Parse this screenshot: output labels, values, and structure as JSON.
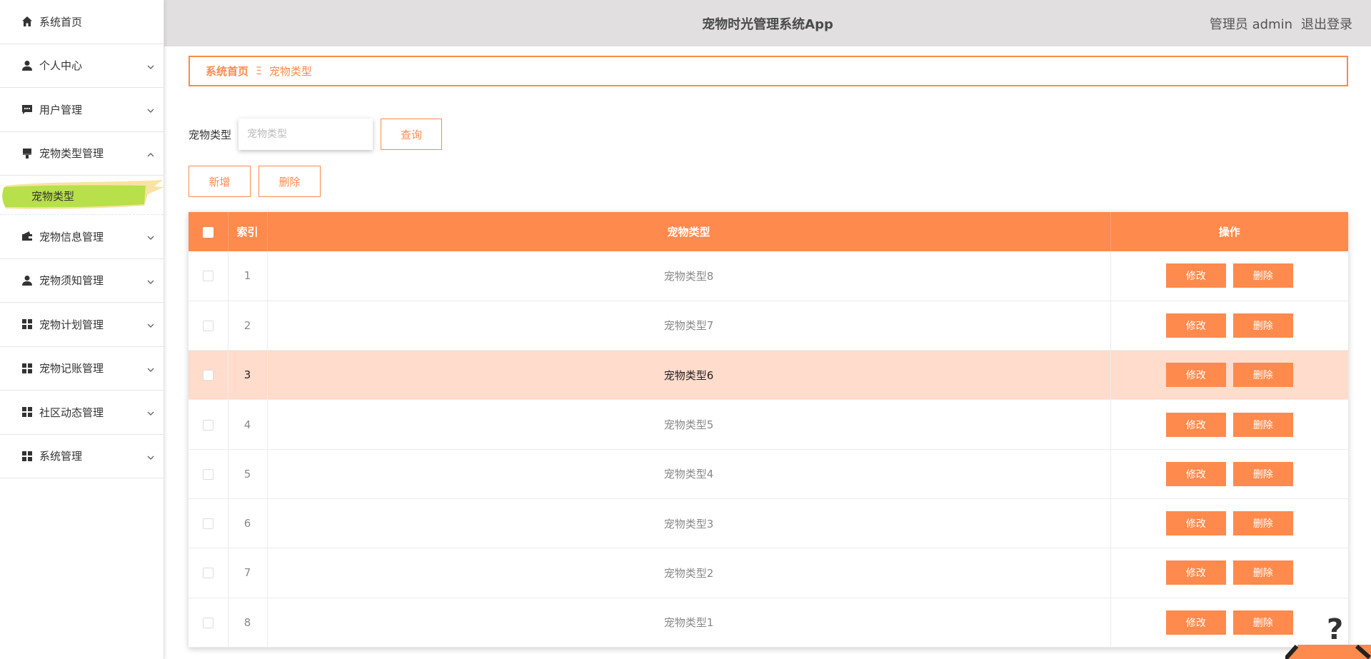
{
  "app": {
    "title": "宠物时光管理系统App",
    "user_label": "管理员 admin",
    "logout_label": "退出登录"
  },
  "colors": {
    "accent": "#ff8a4d",
    "active_sub_bg": "#b7e04a",
    "header_bg": "#e1dfe0",
    "highlight_row": "#ffdccc"
  },
  "sidebar": {
    "items": [
      {
        "label": "系统首页",
        "icon": "home-icon",
        "expandable": false
      },
      {
        "label": "个人中心",
        "icon": "person-icon",
        "expandable": true
      },
      {
        "label": "用户管理",
        "icon": "chat-icon",
        "expandable": true
      },
      {
        "label": "宠物类型管理",
        "icon": "brush-icon",
        "expandable": true,
        "expanded": true
      },
      {
        "label": "宠物信息管理",
        "icon": "wallet-icon",
        "expandable": true
      },
      {
        "label": "宠物须知管理",
        "icon": "person-icon",
        "expandable": true
      },
      {
        "label": "宠物计划管理",
        "icon": "grid-icon",
        "expandable": true
      },
      {
        "label": "宠物记账管理",
        "icon": "grid-icon",
        "expandable": true
      },
      {
        "label": "社区动态管理",
        "icon": "grid-icon",
        "expandable": true
      },
      {
        "label": "系统管理",
        "icon": "grid-icon",
        "expandable": true
      }
    ],
    "active_sub": "宠物类型"
  },
  "breadcrumb": {
    "home": "系统首页",
    "separator": "Ξ",
    "current": "宠物类型"
  },
  "search": {
    "label": "宠物类型",
    "placeholder": "宠物类型",
    "value": "",
    "button": "查询"
  },
  "actions": {
    "add": "新增",
    "delete": "删除"
  },
  "table": {
    "headers": [
      "索引",
      "宠物类型",
      "操作"
    ],
    "edit_label": "修改",
    "delete_label": "删除",
    "rows": [
      {
        "index": "1",
        "type": "宠物类型8"
      },
      {
        "index": "2",
        "type": "宠物类型7"
      },
      {
        "index": "3",
        "type": "宠物类型6"
      },
      {
        "index": "4",
        "type": "宠物类型5"
      },
      {
        "index": "5",
        "type": "宠物类型4"
      },
      {
        "index": "6",
        "type": "宠物类型3"
      },
      {
        "index": "7",
        "type": "宠物类型2"
      },
      {
        "index": "8",
        "type": "宠物类型1"
      }
    ]
  }
}
